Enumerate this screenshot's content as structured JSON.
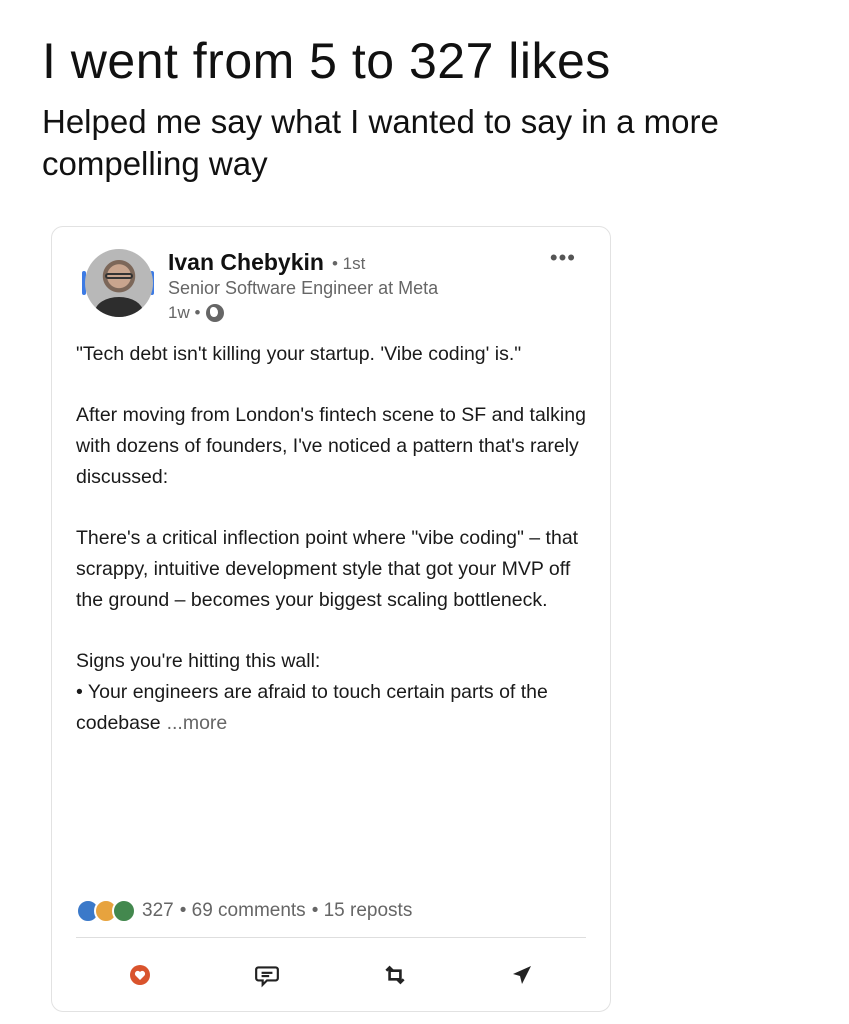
{
  "headline": "I went from 5 to 327 likes",
  "subline": "Helped me say what I wanted to say in a more compelling way",
  "post": {
    "author": "Ivan Chebykin",
    "degree": "• 1st",
    "title": "Senior Software Engineer at Meta",
    "time": "1w •",
    "more_menu": "•••",
    "paragraphs": [
      "\"Tech debt isn't killing your startup. 'Vibe coding' is.\"",
      "After moving from London's fintech scene to SF and talking with dozens of founders, I've noticed a pattern that's rarely discussed:",
      "There's a critical inflection point where \"vibe coding\" – that scrappy, intuitive development style that got your MVP off the ground – becomes your biggest scaling bottleneck."
    ],
    "signs_heading": "Signs you're hitting this wall:",
    "bullet_1": "• Your engineers are afraid to touch certain parts of the codebase",
    "more_link": "...more",
    "reactions_count": "327",
    "comments": "• 69 comments",
    "reposts": "• 15 reposts",
    "reaction_icons": [
      "like-icon",
      "insightful-icon",
      "support-icon"
    ],
    "actions": [
      "like",
      "comment",
      "repost",
      "send"
    ]
  },
  "colors": {
    "like_red": "#d9532c",
    "link_blue": "#3d7be4",
    "muted": "#666666"
  }
}
